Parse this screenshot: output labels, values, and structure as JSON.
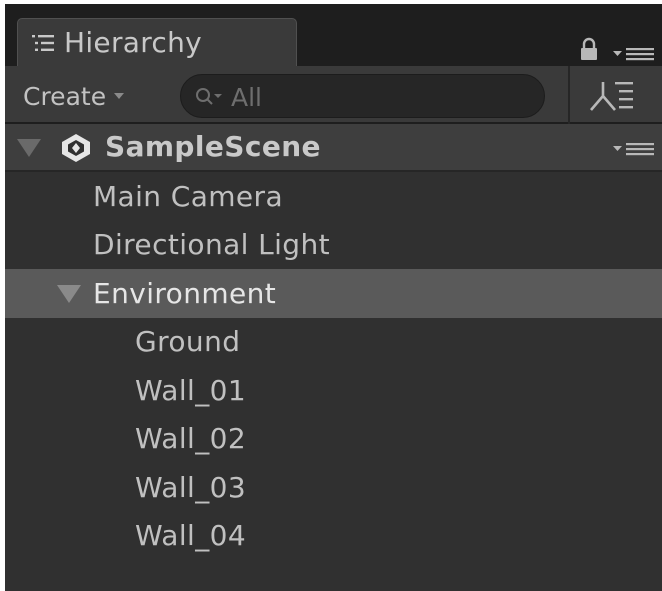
{
  "window": {
    "tab_label": "Hierarchy",
    "tab_icon": "list-icon",
    "lock_icon": "lock-icon",
    "menu_icon": "menu-icon"
  },
  "toolbar": {
    "create_label": "Create",
    "create_caret": "caret-down-icon",
    "search_placeholder": "All",
    "search_icon": "search-icon",
    "filter_icon": "hierarchy-filter-icon"
  },
  "scene": {
    "name": "SampleScene",
    "icon": "unity-icon",
    "expanded": true
  },
  "items": [
    {
      "label": "Main Camera",
      "depth": 1,
      "selected": false
    },
    {
      "label": "Directional Light",
      "depth": 1,
      "selected": false
    },
    {
      "label": "Environment",
      "depth": 1,
      "selected": true,
      "expanded": true
    },
    {
      "label": "Ground",
      "depth": 2,
      "selected": false
    },
    {
      "label": "Wall_01",
      "depth": 2,
      "selected": false
    },
    {
      "label": "Wall_02",
      "depth": 2,
      "selected": false
    },
    {
      "label": "Wall_03",
      "depth": 2,
      "selected": false
    },
    {
      "label": "Wall_04",
      "depth": 2,
      "selected": false
    }
  ],
  "colors": {
    "panel_bg": "#303030",
    "selected_row": "#5a5a5a",
    "text": "#c0c0c0"
  }
}
